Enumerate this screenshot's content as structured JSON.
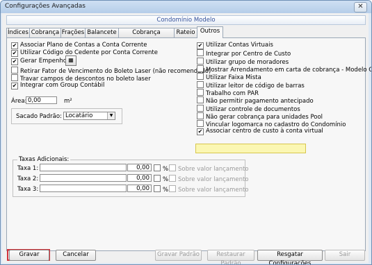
{
  "window": {
    "title": "Configurações Avançadas",
    "close_label": "✕"
  },
  "header": "Condomínio Modelo",
  "tabs": [
    "Índices",
    "Cobrança",
    "Frações",
    "Balancete",
    "Cobrança Avançada",
    "Rateio",
    "Outros"
  ],
  "active_tab": "Outros",
  "left_checks": [
    {
      "label": "Associar Plano de Contas a Conta Corrente",
      "checked": true
    },
    {
      "label": "Utilizar Código do Cedente por Conta Corrente",
      "checked": true
    },
    {
      "label": "Gerar Empenho",
      "checked": true
    },
    {
      "label": "Retirar Fator de Vencimento do Boleto Laser (não recomendado)",
      "checked": false
    },
    {
      "label": "Travar campos de descontos no boleto laser",
      "checked": false
    },
    {
      "label": "Integrar com Group Contábil",
      "checked": true
    }
  ],
  "right_checks": [
    {
      "label": "Utilizar Contas Virtuais",
      "checked": true
    },
    {
      "label": "Integrar por Centro de Custo",
      "checked": false
    },
    {
      "label": "Utilizar grupo de moradores",
      "checked": false
    },
    {
      "label": "Mostrar Arrendamento em carta de cobrança - Modelo CEF",
      "checked": false
    },
    {
      "label": "Utilizar Faixa Mista",
      "checked": false
    },
    {
      "label": "Utilizar leitor de código de barras",
      "checked": false
    },
    {
      "label": "Trabalho com PAR",
      "checked": false
    },
    {
      "label": "Não permitir pagamento antecipado",
      "checked": false
    },
    {
      "label": "Utilizar controle de documentos",
      "checked": false
    },
    {
      "label": "Não gerar cobrança para unidades Pool",
      "checked": false
    },
    {
      "label": "Vincular logomarca no cadastro do Condomínio",
      "checked": false
    },
    {
      "label": "Associar centro de custo à conta virtual",
      "checked": true
    }
  ],
  "area": {
    "label": "Área:",
    "value": "0,00",
    "unit": "m²"
  },
  "sacado": {
    "label": "Sacado Padrão:",
    "value": "Locatário"
  },
  "taxas": {
    "title": "Taxas Adicionais:",
    "rows": [
      {
        "label": "Taxa 1:",
        "value": "0,00",
        "pct": "%",
        "sobre": "Sobre valor lançamento"
      },
      {
        "label": "Taxa 2:",
        "value": "0,00",
        "pct": "%",
        "sobre": "Sobre valor lançamento"
      },
      {
        "label": "Taxa 3:",
        "value": "0,00",
        "pct": "%",
        "sobre": "Sobre valor lançamento"
      }
    ]
  },
  "buttons": {
    "gravar": "Gravar",
    "cancelar": "Cancelar",
    "gravar_padrao": "Gravar Padrão",
    "restaurar_padrao": "Restaurar Padrão",
    "resgatar": "Resgatar Configurações",
    "sair": "Sair"
  },
  "colors": {
    "highlight": "#fbf7b3",
    "red_frame": "#d3333b",
    "header_text": "#33509a"
  }
}
